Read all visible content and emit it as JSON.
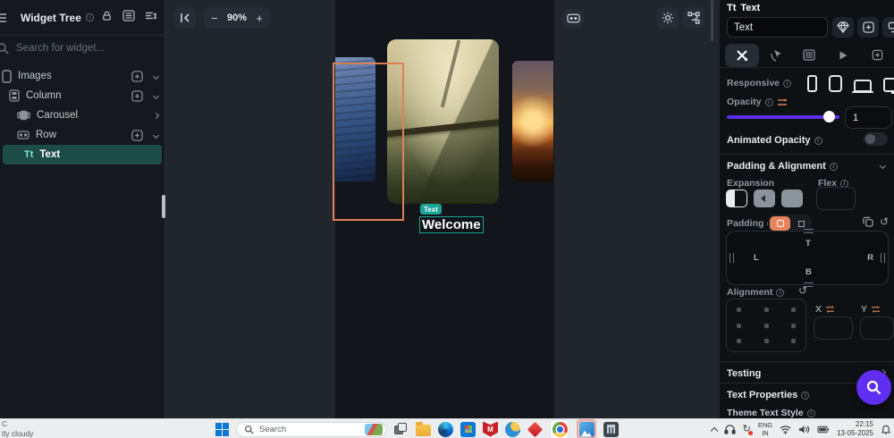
{
  "sidebar": {
    "title": "Widget Tree",
    "search_placeholder": "Search for widget...",
    "tree": [
      {
        "label": "Images",
        "icon": "phone-icon",
        "selected": false
      },
      {
        "label": "Column",
        "icon": "column-icon",
        "selected": false
      },
      {
        "label": "Carousel",
        "icon": "carousel-icon",
        "selected": false
      },
      {
        "label": "Row",
        "icon": "row-icon",
        "selected": false
      },
      {
        "label": "Text",
        "icon": "text-icon",
        "selected": true
      }
    ],
    "header_icons": [
      "tree-outline-icon",
      "lock-icon",
      "panel-list-icon",
      "sort-collapse-icon"
    ]
  },
  "canvas": {
    "collapse_icon": "collapse-left-icon",
    "zoom_out_label": "−",
    "zoom_value": "90%",
    "zoom_in_label": "+",
    "toolbar_icons": [
      "board-icon",
      "sun-icon",
      "vector-nodes-icon"
    ],
    "widget_badge": "Text",
    "welcome_text": "Welcome",
    "selection_color": "#dd8058"
  },
  "inspector": {
    "widget_type_label": "Text",
    "widget_name_value": "Text",
    "header_icons": [
      "gem-icon",
      "add-widget-icon",
      "transform-icon"
    ],
    "tab_icons": [
      "tools-icon",
      "action-cursor-icon",
      "list-icon",
      "play-icon",
      "doc-plus-icon"
    ],
    "responsive_label": "Responsive",
    "device_icons": [
      "phone-icon",
      "tablet-icon",
      "laptop-icon",
      "desktop-icon"
    ],
    "opacity_label": "Opacity",
    "opacity_value": "1",
    "animated_opacity_label": "Animated Opacity",
    "padding_alignment_label": "Padding & Alignment",
    "expansion_label": "Expansion",
    "flex_label": "Flex",
    "padding_label": "Padding",
    "padding_top_label": "T",
    "padding_left_label": "L",
    "padding_bottom_label": "B",
    "padding_right_label": "R",
    "alignment_label": "Alignment",
    "x_label": "X",
    "y_label": "Y",
    "testing_label": "Testing",
    "text_properties_label": "Text Properties",
    "theme_text_style_label": "Theme Text Style",
    "accent_purple": "#5b2ee8",
    "accent_orange": "#e8845c",
    "fab_color": "#5f2ef0"
  },
  "taskbar": {
    "weather_temp": "C",
    "weather_condition": "tly cloudy",
    "search_label": "Search",
    "language_top": "ENG",
    "language_bottom": "IN",
    "time": "22:15",
    "date": "13-05-2025",
    "app_icons": [
      "windows-logo",
      "search-pill",
      "task-view-icon",
      "file-explorer-icon",
      "edge-icon",
      "store-icon",
      "mcafee-icon",
      "msn-weather-icon",
      "diamond-app-icon",
      "chrome-icon",
      "photos-icon",
      "calculator-icon"
    ],
    "tray_icons": [
      "tray-expand-icon",
      "headphones-icon",
      "sync-icon",
      "wifi-icon",
      "speaker-icon",
      "battery-icon",
      "bell-icon"
    ]
  },
  "colors": {
    "accent_teal": "#1ba395"
  }
}
